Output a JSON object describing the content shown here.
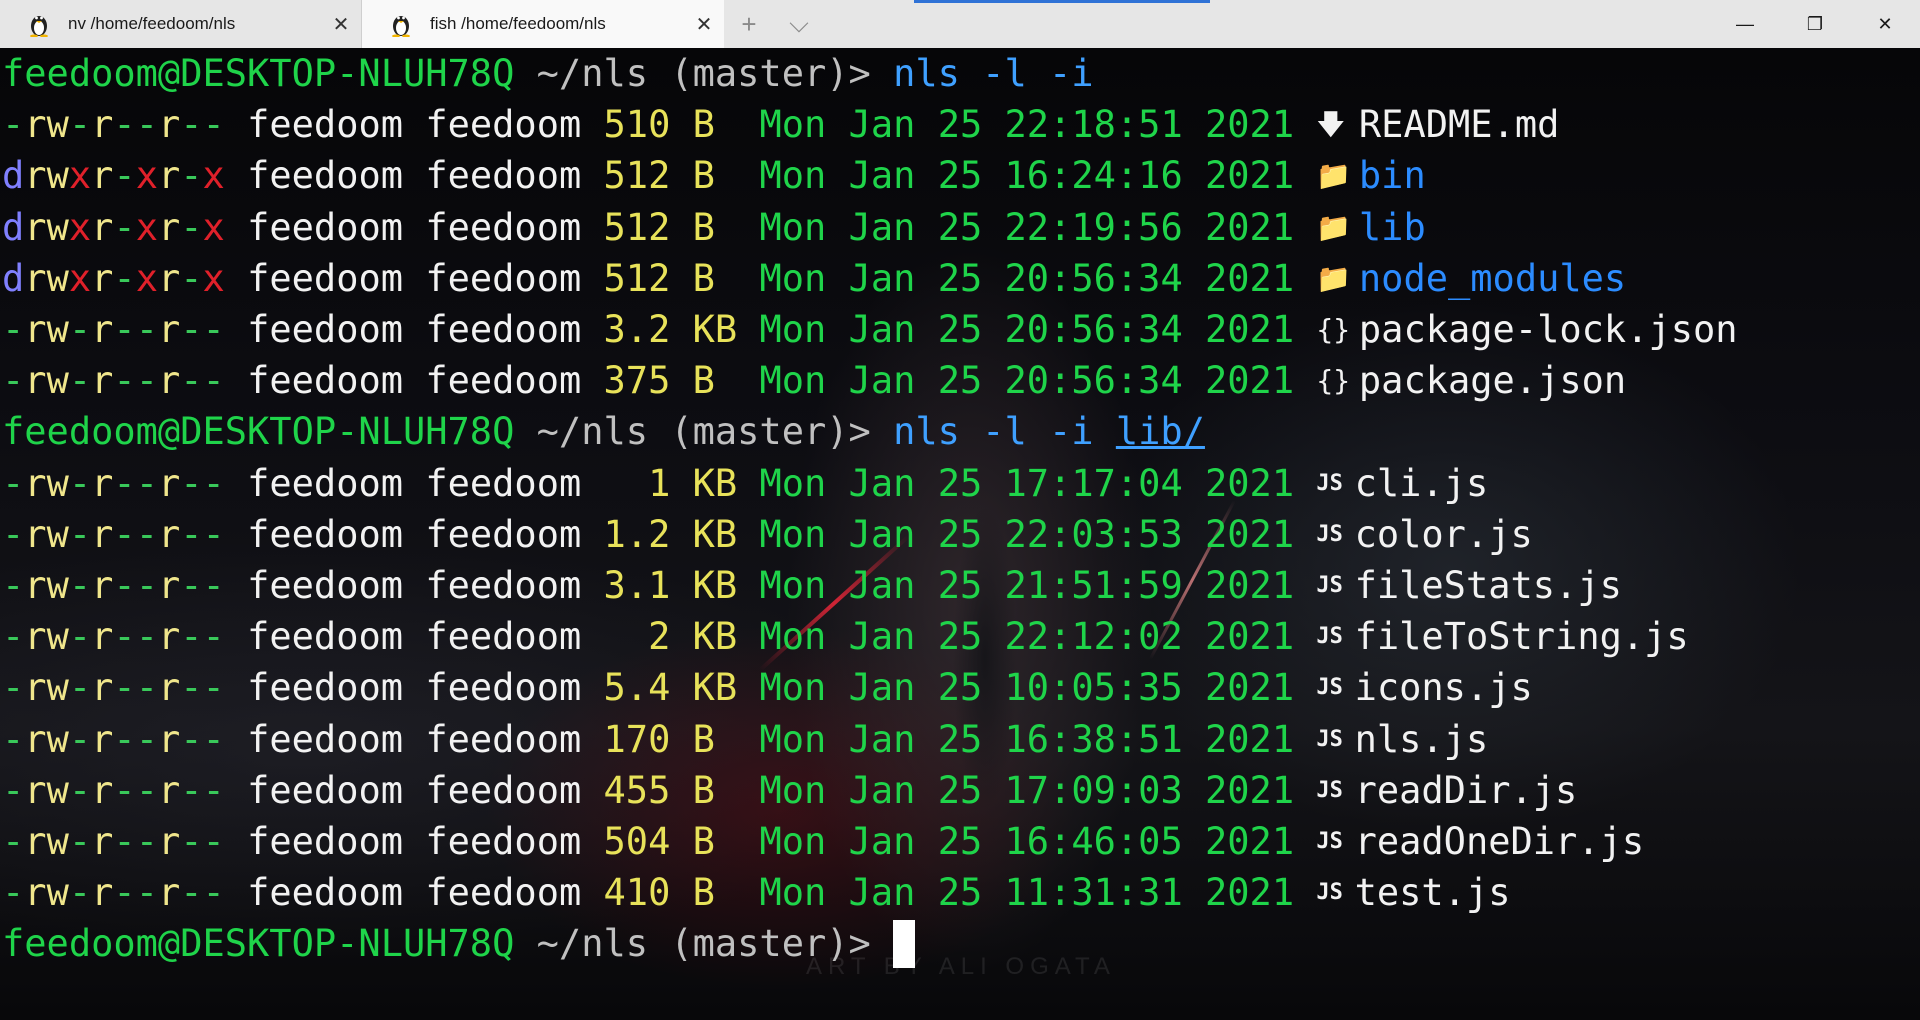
{
  "tabs": [
    {
      "title": "nv /home/feedoom/nls",
      "close": "✕",
      "active": false
    },
    {
      "title": "fish /home/feedoom/nls",
      "close": "✕",
      "active": true
    }
  ],
  "titlebar": {
    "new_tab": "+",
    "dropdown": "⌵",
    "minimize": "—",
    "maximize": "❐",
    "close": "✕"
  },
  "prompt": {
    "user_host": "feedoom@DESKTOP-NLUH78Q",
    "cwd": "~/nls",
    "branch": "(master)>"
  },
  "commands": [
    {
      "cmd": "nls -l -i",
      "arg": ""
    },
    {
      "cmd": "nls -l -i",
      "arg": "lib/"
    }
  ],
  "listing1": [
    {
      "perm": "-rw-r--r--",
      "user": "feedoom",
      "group": "feedoom",
      "size": "510",
      "unit": "B ",
      "date": "Mon Jan 25 22:18:51 2021",
      "icon": "download-icon",
      "glyph": "🡇",
      "name": "README.md",
      "kind": "file"
    },
    {
      "perm": "drwxr-xr-x",
      "user": "feedoom",
      "group": "feedoom",
      "size": "512",
      "unit": "B ",
      "date": "Mon Jan 25 16:24:16 2021",
      "icon": "folder-icon",
      "glyph": "📁",
      "name": "bin",
      "kind": "dir"
    },
    {
      "perm": "drwxr-xr-x",
      "user": "feedoom",
      "group": "feedoom",
      "size": "512",
      "unit": "B ",
      "date": "Mon Jan 25 22:19:56 2021",
      "icon": "folder-icon",
      "glyph": "📁",
      "name": "lib",
      "kind": "dir"
    },
    {
      "perm": "drwxr-xr-x",
      "user": "feedoom",
      "group": "feedoom",
      "size": "512",
      "unit": "B ",
      "date": "Mon Jan 25 20:56:34 2021",
      "icon": "folder-icon",
      "glyph": "📁",
      "name": "node_modules",
      "kind": "dir"
    },
    {
      "perm": "-rw-r--r--",
      "user": "feedoom",
      "group": "feedoom",
      "size": "3.2",
      "unit": "KB",
      "date": "Mon Jan 25 20:56:34 2021",
      "icon": "json-braces-icon",
      "glyph": "{}",
      "name": "package-lock.json",
      "kind": "file"
    },
    {
      "perm": "-rw-r--r--",
      "user": "feedoom",
      "group": "feedoom",
      "size": "375",
      "unit": "B ",
      "date": "Mon Jan 25 20:56:34 2021",
      "icon": "json-braces-icon",
      "glyph": "{}",
      "name": "package.json",
      "kind": "file"
    }
  ],
  "listing2": [
    {
      "perm": "-rw-r--r--",
      "user": "feedoom",
      "group": "feedoom",
      "size": "  1",
      "unit": "KB",
      "date": "Mon Jan 25 17:17:04 2021",
      "icon": "js-icon",
      "glyph": "JS",
      "name": "cli.js",
      "kind": "file"
    },
    {
      "perm": "-rw-r--r--",
      "user": "feedoom",
      "group": "feedoom",
      "size": "1.2",
      "unit": "KB",
      "date": "Mon Jan 25 22:03:53 2021",
      "icon": "js-icon",
      "glyph": "JS",
      "name": "color.js",
      "kind": "file"
    },
    {
      "perm": "-rw-r--r--",
      "user": "feedoom",
      "group": "feedoom",
      "size": "3.1",
      "unit": "KB",
      "date": "Mon Jan 25 21:51:59 2021",
      "icon": "js-icon",
      "glyph": "JS",
      "name": "fileStats.js",
      "kind": "file"
    },
    {
      "perm": "-rw-r--r--",
      "user": "feedoom",
      "group": "feedoom",
      "size": "  2",
      "unit": "KB",
      "date": "Mon Jan 25 22:12:02 2021",
      "icon": "js-icon",
      "glyph": "JS",
      "name": "fileToString.js",
      "kind": "file"
    },
    {
      "perm": "-rw-r--r--",
      "user": "feedoom",
      "group": "feedoom",
      "size": "5.4",
      "unit": "KB",
      "date": "Mon Jan 25 10:05:35 2021",
      "icon": "js-icon",
      "glyph": "JS",
      "name": "icons.js",
      "kind": "file"
    },
    {
      "perm": "-rw-r--r--",
      "user": "feedoom",
      "group": "feedoom",
      "size": "170",
      "unit": "B ",
      "date": "Mon Jan 25 16:38:51 2021",
      "icon": "js-icon",
      "glyph": "JS",
      "name": "nls.js",
      "kind": "file"
    },
    {
      "perm": "-rw-r--r--",
      "user": "feedoom",
      "group": "feedoom",
      "size": "455",
      "unit": "B ",
      "date": "Mon Jan 25 17:09:03 2021",
      "icon": "js-icon",
      "glyph": "JS",
      "name": "readDir.js",
      "kind": "file"
    },
    {
      "perm": "-rw-r--r--",
      "user": "feedoom",
      "group": "feedoom",
      "size": "504",
      "unit": "B ",
      "date": "Mon Jan 25 16:46:05 2021",
      "icon": "js-icon",
      "glyph": "JS",
      "name": "readOneDir.js",
      "kind": "file"
    },
    {
      "perm": "-rw-r--r--",
      "user": "feedoom",
      "group": "feedoom",
      "size": "410",
      "unit": "B ",
      "date": "Mon Jan 25 11:31:31 2021",
      "icon": "js-icon",
      "glyph": "JS",
      "name": "test.js",
      "kind": "file"
    }
  ],
  "watermark": "ART BY ALI OGATA",
  "colors": {
    "green": "#1fd44a",
    "blue": "#2c8cff",
    "red": "#e0202a",
    "yellow": "#e8e25a",
    "white": "#f2f2f2"
  }
}
